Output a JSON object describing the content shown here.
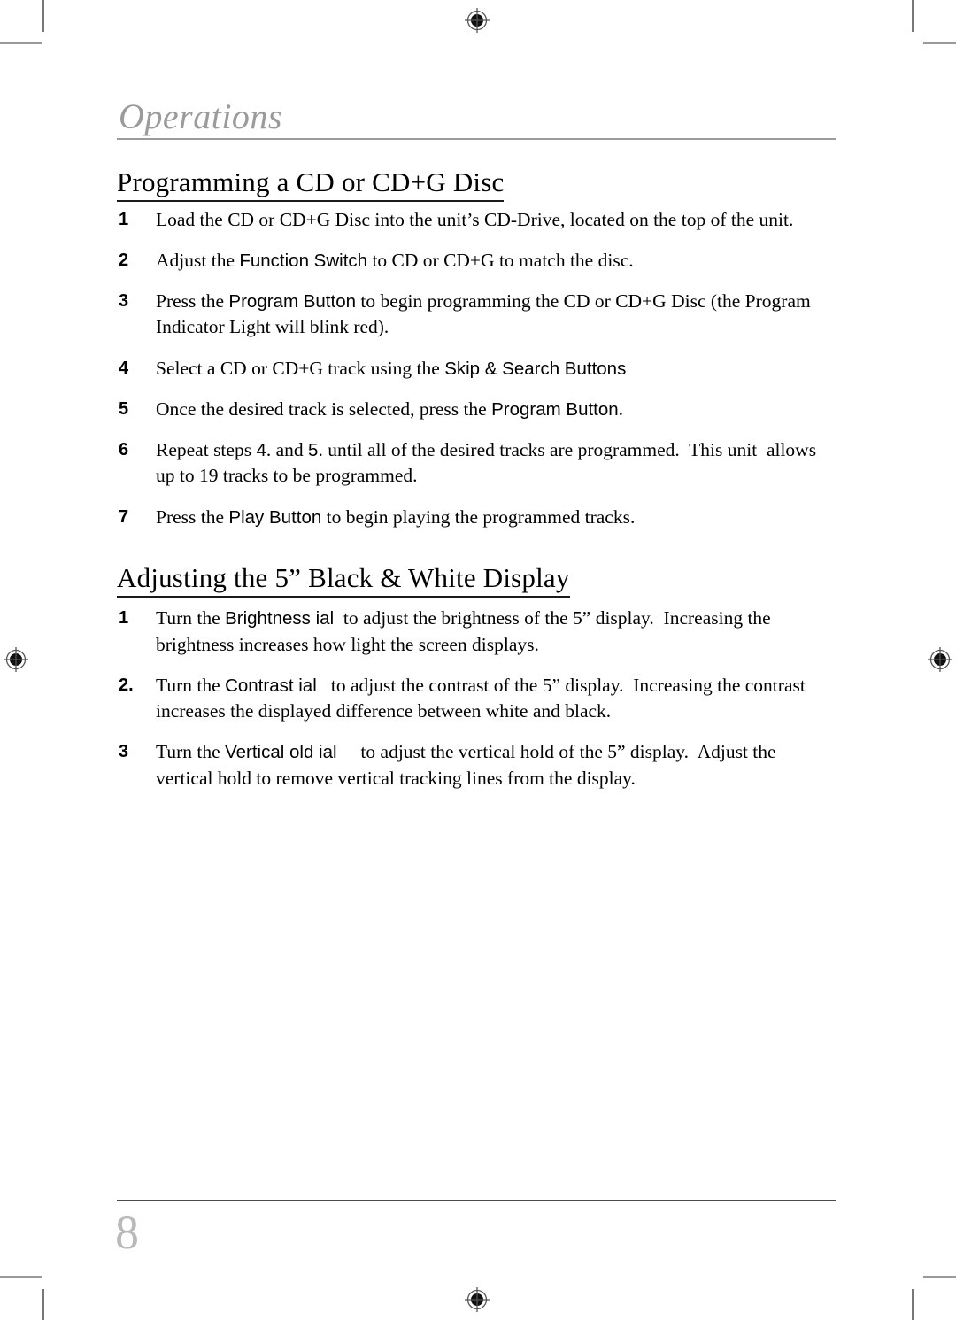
{
  "document": {
    "chapter_title": "Operations",
    "page_number": "8",
    "colors": {
      "chapter_title": "#9b9b9b",
      "page_number": "#b9b9b9",
      "body_text": "#000000",
      "rule": "#9b9b9b",
      "footer_rule": "#4a4a4a"
    }
  },
  "sections": [
    {
      "heading": "Programming a CD or CD+G Disc",
      "steps": [
        {
          "number": "1",
          "parts": [
            {
              "text": "Load the CD or CD+G Disc into the unit’s CD-Drive, located on the top of the unit.",
              "style": "serif"
            }
          ]
        },
        {
          "number": "2",
          "parts": [
            {
              "text": "Adjust the ",
              "style": "serif"
            },
            {
              "text": "Function Switch",
              "style": "sans"
            },
            {
              "text": " to CD or CD+G to match the disc.",
              "style": "serif"
            }
          ]
        },
        {
          "number": "3",
          "parts": [
            {
              "text": "Press the ",
              "style": "serif"
            },
            {
              "text": "Program Button",
              "style": "sans"
            },
            {
              "text": " to begin programming the CD or CD+G Disc (the Program Indicator Light will blink red).",
              "style": "serif"
            }
          ]
        },
        {
          "number": "4",
          "parts": [
            {
              "text": "Select a CD or CD+G track using the ",
              "style": "serif"
            },
            {
              "text": "Skip & Search Buttons",
              "style": "sans"
            }
          ]
        },
        {
          "number": "5",
          "parts": [
            {
              "text": "Once the desired track is selected, press the ",
              "style": "serif"
            },
            {
              "text": "Program Button",
              "style": "sans"
            },
            {
              "text": ".",
              "style": "serif"
            }
          ]
        },
        {
          "number": "6",
          "parts": [
            {
              "text": "Repeat steps ",
              "style": "serif"
            },
            {
              "text": "4",
              "style": "sans"
            },
            {
              "text": ". and ",
              "style": "serif"
            },
            {
              "text": "5",
              "style": "sans"
            },
            {
              "text": ". until all of the desired tracks are programmed.  This unit  allows up to 19 tracks to be programmed.",
              "style": "serif"
            }
          ]
        },
        {
          "number": "7",
          "parts": [
            {
              "text": "Press the ",
              "style": "serif"
            },
            {
              "text": "Play Button",
              "style": "sans"
            },
            {
              "text": " to begin playing the programmed tracks.",
              "style": "serif"
            }
          ]
        }
      ]
    },
    {
      "heading": "Adjusting the 5” Black & White Display",
      "steps": [
        {
          "number": "1",
          "parts": [
            {
              "text": "Turn the ",
              "style": "serif"
            },
            {
              "text": "Brightness ial",
              "style": "sans"
            },
            {
              "text": "  to adjust the brightness of the 5” display.  Increasing the brightness increases how light the screen displays.",
              "style": "serif"
            }
          ]
        },
        {
          "number": "2.",
          "parts": [
            {
              "text": "Turn the ",
              "style": "serif"
            },
            {
              "text": "Contrast ial",
              "style": "sans"
            },
            {
              "text": "   to adjust the contrast of the 5” display.  Increasing the contrast increases the displayed difference between white and black.",
              "style": "serif"
            }
          ]
        },
        {
          "number": "3",
          "parts": [
            {
              "text": "Turn the ",
              "style": "serif"
            },
            {
              "text": "Vertical old ial",
              "style": "sans"
            },
            {
              "text": "     to adjust the vertical hold of the 5” display.  Adjust the vertical hold to remove vertical tracking lines from the display.",
              "style": "serif"
            }
          ]
        }
      ]
    }
  ],
  "printer_marks": {
    "registration_icon": "registration-target-icon",
    "crop_mark_icon": "crop-mark-line"
  }
}
